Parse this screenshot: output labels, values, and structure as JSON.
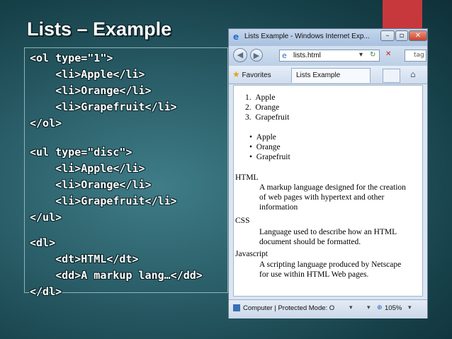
{
  "slide": {
    "title": "Lists – Example",
    "accent_color": "#c6383c"
  },
  "code_lines": [
    "<ol type=\"1\">",
    "    <li>Apple</li>",
    "    <li>Orange</li>",
    "    <li>Grapefruit</li>",
    "</ol>",
    "",
    "<ul type=\"disc\">",
    "    <li>Apple</li>",
    "    <li>Orange</li>",
    "    <li>Grapefruit</li>",
    "</ul>",
    "",
    "<dl>",
    "    <dt>HTML</dt>",
    "    <dd>A markup lang…</dd>",
    "</dl>"
  ],
  "browser": {
    "window_title": "Lists Example - Windows Internet Exp...",
    "address": "lists.html",
    "search_text": "tag i",
    "favorites_label": "Favorites",
    "tab_label": "Lists Example",
    "status_text": "Computer | Protected Mode: O",
    "zoom": "105%",
    "icons": [
      "ie-icon",
      "back-icon",
      "forward-icon",
      "refresh-icon",
      "stop-icon",
      "search-icon",
      "star-icon",
      "home-icon",
      "security-icon",
      "zoom-icon"
    ]
  },
  "page": {
    "ordered_list": [
      "Apple",
      "Orange",
      "Grapefruit"
    ],
    "unordered_list": [
      "Apple",
      "Orange",
      "Grapefruit"
    ],
    "definitions": [
      {
        "term": "HTML",
        "lines": [
          "A markup language designed for the creation",
          "of web pages with hypertext and other",
          "information"
        ]
      },
      {
        "term": "CSS",
        "lines": [
          "Language used to describe how an HTML",
          "document should be formatted."
        ]
      },
      {
        "term": "Javascript",
        "lines": [
          "A scripting language produced by Netscape",
          "for use within HTML Web pages."
        ]
      }
    ]
  }
}
